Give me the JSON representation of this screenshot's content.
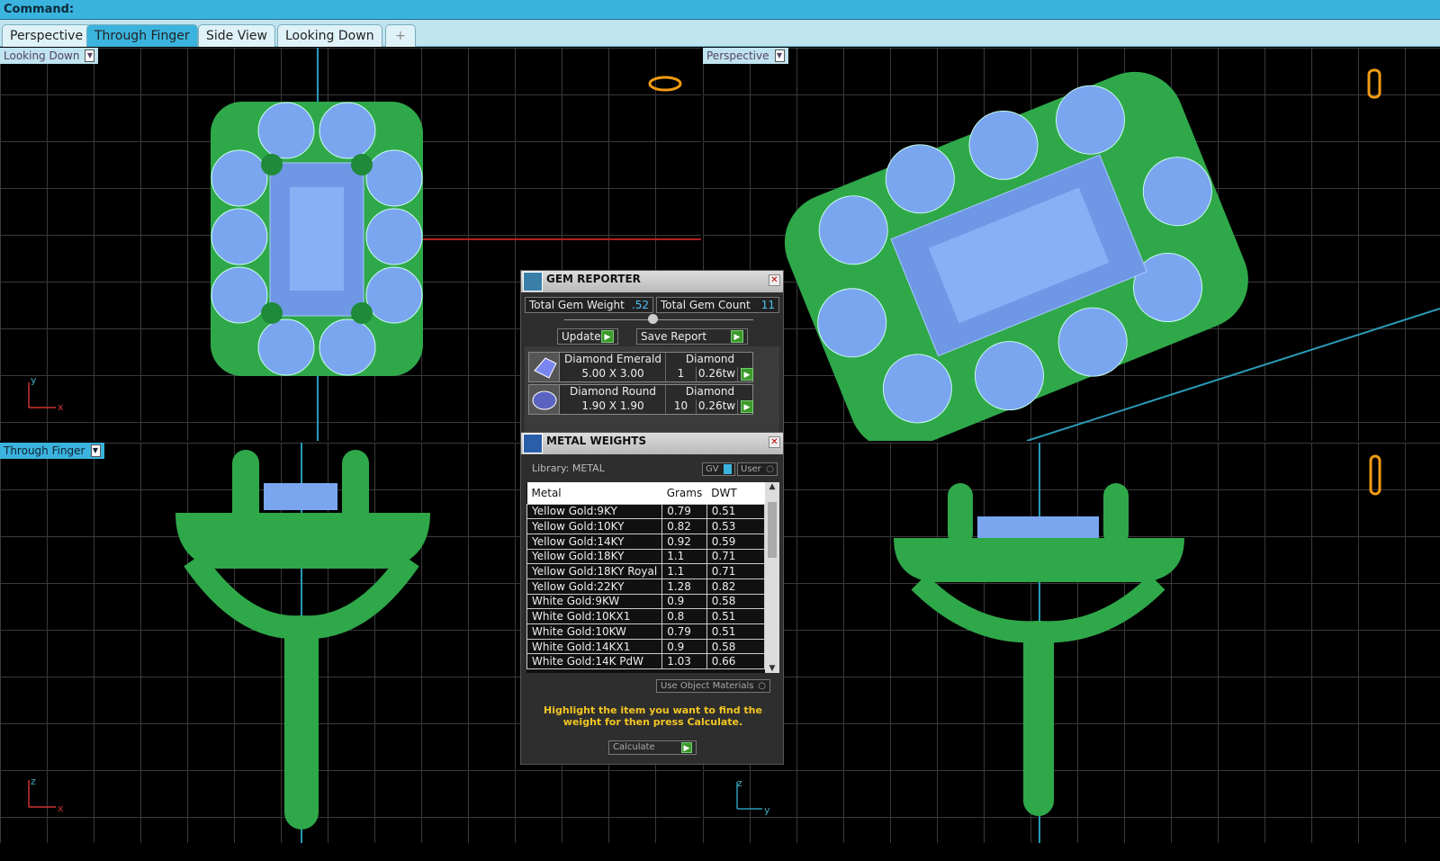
{
  "command": {
    "label": "Command:"
  },
  "tabs": [
    {
      "label": "Perspective"
    },
    {
      "label": "Through Finger",
      "active": true
    },
    {
      "label": "Side View"
    },
    {
      "label": "Looking Down"
    },
    {
      "label": "+"
    }
  ],
  "viewports": {
    "top_left": {
      "label": "Looking Down",
      "axes": [
        "y",
        "x"
      ]
    },
    "top_right": {
      "label": "Perspective"
    },
    "bottom_left": {
      "label": "Through Finger",
      "axes": [
        "z",
        "x"
      ]
    },
    "bottom_right": {
      "axes": [
        "z",
        "y"
      ]
    }
  },
  "colors": {
    "metal": "#2fa84a",
    "gem": "#7aa6f0",
    "accent": "#3ab4de",
    "highlight": "#f3c623"
  },
  "gem_reporter": {
    "title": "GEM REPORTER",
    "total_weight_label": "Total Gem Weight",
    "total_weight": ".52",
    "total_count_label": "Total Gem Count",
    "total_count": "11",
    "update": "Update",
    "save_report": "Save Report",
    "gems": [
      {
        "name": "Diamond Emerald",
        "material": "Diamond",
        "size": "5.00 X 3.00",
        "count": "1",
        "weight": "0.26tw"
      },
      {
        "name": "Diamond Round",
        "material": "Diamond",
        "size": "1.90 X 1.90",
        "count": "10",
        "weight": "0.26tw"
      }
    ]
  },
  "metal_weights": {
    "title": "METAL WEIGHTS",
    "library": "Library: METAL",
    "gv": "GV",
    "user": "User",
    "headers": [
      "Metal",
      "Grams",
      "DWT"
    ],
    "rows": [
      [
        "Yellow Gold:9KY",
        "0.79",
        "0.51"
      ],
      [
        "Yellow Gold:10KY",
        "0.82",
        "0.53"
      ],
      [
        "Yellow Gold:14KY",
        "0.92",
        "0.59"
      ],
      [
        "Yellow Gold:18KY",
        "1.1",
        "0.71"
      ],
      [
        "Yellow Gold:18KY Royal",
        "1.1",
        "0.71"
      ],
      [
        "Yellow Gold:22KY",
        "1.28",
        "0.82"
      ],
      [
        "White Gold:9KW",
        "0.9",
        "0.58"
      ],
      [
        "White Gold:10KX1",
        "0.8",
        "0.51"
      ],
      [
        "White Gold:10KW",
        "0.79",
        "0.51"
      ],
      [
        "White Gold:14KX1",
        "0.9",
        "0.58"
      ],
      [
        "White Gold:14K PdW",
        "1.03",
        "0.66"
      ]
    ],
    "use_object_materials": "Use Object Materials",
    "hint": "Highlight the item you want to find the weight for then press Calculate.",
    "calculate": "Calculate"
  }
}
